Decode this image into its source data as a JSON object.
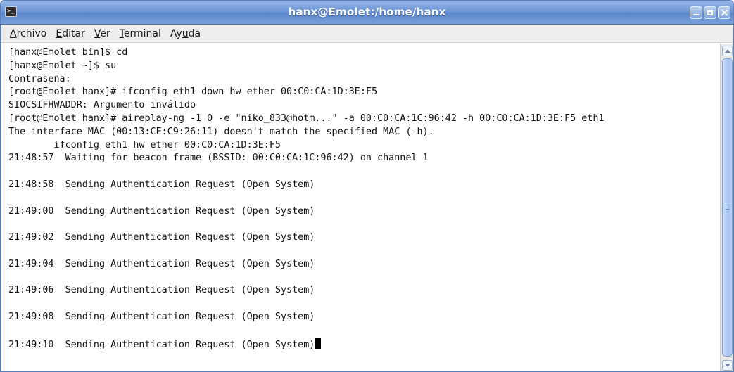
{
  "window": {
    "title": "hanx@Emolet:/home/hanx",
    "icon": "terminal-icon"
  },
  "menu": {
    "items": [
      {
        "accel": "A",
        "rest": "rchivo"
      },
      {
        "accel": "E",
        "rest": "ditar"
      },
      {
        "accel": "V",
        "rest": "er"
      },
      {
        "accel": "T",
        "rest": "erminal"
      },
      {
        "pre": "Ay",
        "accel": "u",
        "rest": "da"
      }
    ]
  },
  "terminal": {
    "lines": [
      "[hanx@Emolet bin]$ cd",
      "[hanx@Emolet ~]$ su",
      "Contraseña:",
      "[root@Emolet hanx]# ifconfig eth1 down hw ether 00:C0:CA:1D:3E:F5",
      "SIOCSIFHWADDR: Argumento inválido",
      "[root@Emolet hanx]# aireplay-ng -1 0 -e \"niko_833@hotm...\" -a 00:C0:CA:1C:96:42 -h 00:C0:CA:1D:3E:F5 eth1",
      "The interface MAC (00:13:CE:C9:26:11) doesn't match the specified MAC (-h).",
      "        ifconfig eth1 hw ether 00:C0:CA:1D:3E:F5",
      "21:48:57  Waiting for beacon frame (BSSID: 00:C0:CA:1C:96:42) on channel 1",
      "",
      "21:48:58  Sending Authentication Request (Open System)",
      "",
      "21:49:00  Sending Authentication Request (Open System)",
      "",
      "21:49:02  Sending Authentication Request (Open System)",
      "",
      "21:49:04  Sending Authentication Request (Open System)",
      "",
      "21:49:06  Sending Authentication Request (Open System)",
      "",
      "21:49:08  Sending Authentication Request (Open System)",
      "",
      "21:49:10  Sending Authentication Request (Open System)"
    ]
  },
  "colors": {
    "titlebar": "#6f98d6",
    "menubar": "#ededed",
    "terminal_bg": "#ffffff",
    "terminal_fg": "#111111"
  }
}
